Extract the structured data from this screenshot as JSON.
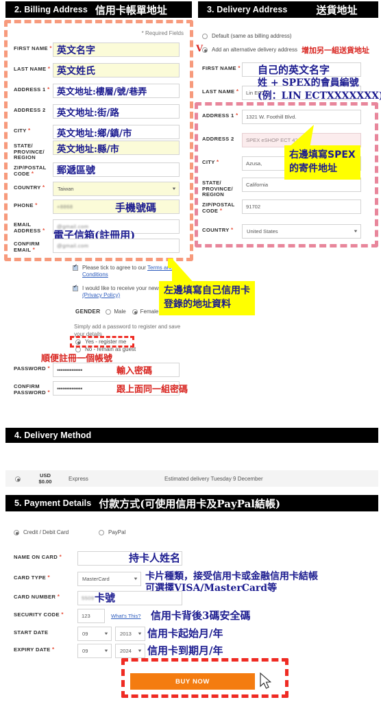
{
  "sections": {
    "billing": {
      "num": "2. Billing Address",
      "cn": "信用卡帳單地址"
    },
    "delivery": {
      "num": "3. Delivery Address",
      "cn": "送貨地址"
    },
    "delivery_method": {
      "num": "4. Delivery Method",
      "cn": ""
    },
    "payment": {
      "num": "5. Payment Details",
      "cn": "付款方式(可使用信用卡及PayPal結帳)"
    }
  },
  "billing": {
    "required_note": "* Required Fields",
    "fields": [
      {
        "label": "FIRST NAME",
        "required": true,
        "value": "英文名字",
        "style": "yellow"
      },
      {
        "label": "LAST NAME",
        "required": true,
        "value": "英文姓氏",
        "style": "yellow"
      },
      {
        "label": "ADDRESS 1",
        "required": true,
        "value": "英文地址:樓層/號/巷弄",
        "style": "white"
      },
      {
        "label": "ADDRESS 2",
        "required": false,
        "value": "英文地址:街/路",
        "style": "white"
      },
      {
        "label": "CITY",
        "required": true,
        "value": "英文地址:鄉/鎮/市",
        "style": "white"
      },
      {
        "label": "STATE/ PROVINCE/ REGION",
        "required": false,
        "value": "英文地址:縣/市",
        "style": "yellow"
      },
      {
        "label": "ZIP/POSTAL CODE",
        "required": true,
        "value": "郵遞區號",
        "style": "white"
      }
    ],
    "country": {
      "label": "COUNTRY",
      "required": true,
      "value": "Taiwan"
    },
    "phone": {
      "label": "PHONE",
      "required": true,
      "value": "+8868"
    },
    "email": {
      "label": "EMAIL ADDRESS",
      "required": true,
      "value": "@gmail.com"
    },
    "confirm_email": {
      "label": "CONFIRM EMAIL",
      "required": true,
      "value": "@gmail.com"
    },
    "terms": {
      "text_a": "Please tick to agree to our ",
      "link": "Terms and Conditions",
      "checked": true
    },
    "newsletter": {
      "text_a": "I would like to receive your newsletter ",
      "link": "(Privacy Policy)",
      "checked": true
    },
    "gender": {
      "label": "GENDER",
      "options": [
        "Male",
        "Female"
      ],
      "selected": "Female"
    },
    "password_intro": "Simply add a password to register and save your details",
    "register_options": [
      {
        "label": "Yes - register me",
        "selected": true
      },
      {
        "label": "No - remain as guest",
        "selected": false
      }
    ],
    "password": {
      "label": "PASSWORD",
      "required": true,
      "value": "••••••••••••••"
    },
    "confirm_password": {
      "label": "CONFIRM PASSWORD",
      "required": true,
      "value": "••••••••••••••"
    }
  },
  "delivery": {
    "options": [
      {
        "label": "Default (same as billing address)",
        "selected": false
      },
      {
        "label": "Add an alternative delivery address",
        "selected": true,
        "cn": "增加另一組送貨地址",
        "marker": "V"
      }
    ],
    "fields": [
      {
        "label": "FIRST NAME",
        "required": true,
        "value": "",
        "style": "white"
      },
      {
        "label": "LAST NAME",
        "required": true,
        "value": "Lin ECT",
        "style": "white"
      },
      {
        "label": "ADDRESS 1",
        "required": true,
        "value": "1321 W. Foothill Blvd.",
        "style": "white"
      },
      {
        "label": "ADDRESS 2",
        "required": false,
        "value": "SPEX eSHOP ECT    4224",
        "style": "pinkish"
      },
      {
        "label": "CITY",
        "required": true,
        "value": "Azusa,",
        "style": "white"
      },
      {
        "label": "STATE/ PROVINCE/ REGION",
        "required": false,
        "value": "California",
        "style": "white"
      },
      {
        "label": "ZIP/POSTAL CODE",
        "required": true,
        "value": "91702",
        "style": "white"
      }
    ],
    "country": {
      "label": "COUNTRY",
      "required": true,
      "value": "United States"
    }
  },
  "delivery_method": {
    "selected": true,
    "currency": "USD",
    "price": "$0.00",
    "name": "Express",
    "estimate": "Estimated delivery Tuesday 9 December"
  },
  "payment": {
    "methods": [
      {
        "label": "Credit / Debit Card",
        "selected": true
      },
      {
        "label": "PayPal",
        "selected": false
      }
    ],
    "name_on_card": {
      "label": "NAME ON CARD",
      "required": true,
      "value": ""
    },
    "card_type": {
      "label": "CARD TYPE",
      "required": true,
      "value": "MasterCard"
    },
    "card_number": {
      "label": "CARD NUMBER",
      "required": true,
      "value": "5509"
    },
    "security_code": {
      "label": "SECURITY CODE",
      "required": true,
      "value": "123",
      "help": "What's This?"
    },
    "start_date": {
      "label": "START DATE",
      "required": false,
      "month": "09",
      "year": "2013"
    },
    "expiry_date": {
      "label": "EXPIRY DATE",
      "required": true,
      "month": "09",
      "year": "2024"
    },
    "buy_button": "BUY NOW"
  },
  "annotations": {
    "phone": "手機號碼",
    "email": "電子信箱(註冊用)",
    "register": "順便註冊一個帳號",
    "password": "輸入密碼",
    "confirm_password": "跟上面同一組密碼",
    "delivery_first_name": "自己的英文名字",
    "delivery_last_name_1": "姓 + SPEX的會員編號",
    "delivery_last_name_2": "(例：LIN ECTXXXXXXX)",
    "name_on_card": "持卡人姓名",
    "card_type_1": "卡片種類，接受信用卡或金融信用卡結帳",
    "card_type_2": "可選擇VISA/MasterCard等",
    "card_number": "卡號",
    "security_code": "信用卡背後3碼安全碼",
    "start_date": "信用卡起始月/年",
    "expiry_date": "信用卡到期月/年"
  },
  "callouts": {
    "billing": {
      "line1": "左邊填寫自己信用卡",
      "line2": "登錄的地址資料"
    },
    "delivery": {
      "line1": "右邊填寫SPEX",
      "line2": "的寄件地址"
    }
  },
  "colors": {
    "section_bar": "#000000",
    "buy_button": "#f47c10",
    "dashed_orange": "#f79a7c",
    "dashed_pink": "#e8869b",
    "dashed_red": "#ef2b23",
    "callout": "#ffff00",
    "annotation_blue": "#1b1b8f",
    "annotation_red": "#d8241f"
  }
}
